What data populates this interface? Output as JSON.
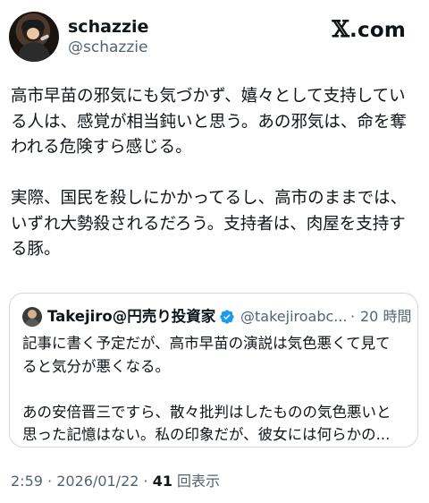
{
  "author": {
    "name": "schazzie",
    "handle": "@schazzie"
  },
  "brand": {
    "logo_glyph": "𝕏",
    "suffix": ".com"
  },
  "tweet": {
    "paragraphs": [
      "高市早苗の邪気にも気づかず、嬉々として支持してい\nる人は、感覚が相当鈍いと思う。あの邪気は、命を奪\nわれる危険すら感じる。",
      "実際、国民を殺しにかかってるし、高市のままでは、\nいずれ大勢殺されるだろう。支持者は、肉屋を支持す\nる豚。"
    ]
  },
  "quote": {
    "name": "Takejiro@円売り投資家",
    "verified_color": "#1d9bf0",
    "handle": "@takejiroabc...",
    "separator": "·",
    "time": "20 時間",
    "paragraphs": [
      "記事に書く予定だが、高市早苗の演説は気色悪くて見て\nると気分が悪くなる。",
      "あの安倍晋三ですら、散々批判はしたものの気色悪いと\n思った記憶はない。私の印象だが、彼女には何らかの..."
    ]
  },
  "meta": {
    "time": "2:59",
    "sep1": " · ",
    "date": "2026/01/22",
    "sep2": " · ",
    "views_count": "41",
    "views_label": " 回表示"
  },
  "colors": {
    "text": "#0f1419",
    "secondary": "#536471",
    "border": "#cfd9de",
    "verified": "#1d9bf0"
  }
}
